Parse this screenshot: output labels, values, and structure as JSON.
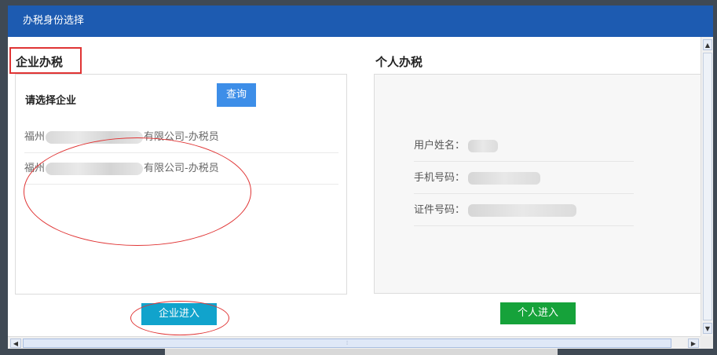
{
  "dialog": {
    "title": "办税身份选择"
  },
  "enterprise": {
    "title": "企业办税",
    "select_label": "请选择企业",
    "query_label": "查询",
    "companies": [
      {
        "prefix": "福州",
        "suffix": "有限公司-办税员"
      },
      {
        "prefix": "福州",
        "suffix": "有限公司-办税员"
      }
    ],
    "enter_label": "企业进入"
  },
  "personal": {
    "title": "个人办税",
    "fields": [
      {
        "label": "用户姓名："
      },
      {
        "label": "手机号码："
      },
      {
        "label": "证件号码："
      }
    ],
    "enter_label": "个人进入"
  },
  "colors": {
    "title_bar": "#1d5bb1",
    "query_button": "#3d8ee8",
    "enterprise_button": "#11a3cc",
    "personal_button": "#16a23a",
    "annotation_red": "#e03434"
  },
  "icons": {
    "scroll_up": "▲",
    "scroll_down": "▼",
    "scroll_left": "◀",
    "scroll_right": "▶",
    "grip": "⦙"
  }
}
